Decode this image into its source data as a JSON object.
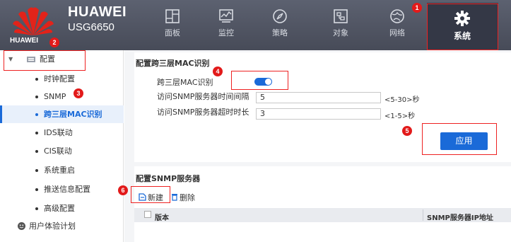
{
  "brand": {
    "name": "HUAWEI",
    "model": "USG6650",
    "logo_text": "HUAWEI"
  },
  "nav": [
    {
      "label": "面板",
      "icon": "dashboard-icon"
    },
    {
      "label": "监控",
      "icon": "monitor-chart-icon"
    },
    {
      "label": "策略",
      "icon": "compass-icon"
    },
    {
      "label": "对象",
      "icon": "object-icon"
    },
    {
      "label": "网络",
      "icon": "globe-network-icon"
    },
    {
      "label": "系统",
      "icon": "gear-icon",
      "active": true
    }
  ],
  "sidebar": {
    "group": "配置",
    "items": [
      "时钟配置",
      "SNMP",
      "跨三层MAC识别",
      "IDS联动",
      "CIS联动",
      "系统重启",
      "推送信息配置",
      "高级配置"
    ],
    "footer": "用户体验计划"
  },
  "section1": {
    "title": "配置跨三层MAC识别",
    "toggle_label": "跨三层MAC识别",
    "toggle_on": true,
    "interval_label": "访问SNMP服务器时间间隔",
    "interval_value": "5",
    "interval_hint": "<5-30>秒",
    "timeout_label": "访问SNMP服务器超时时长",
    "timeout_value": "3",
    "timeout_hint": "<1-5>秒",
    "apply_label": "应用"
  },
  "section2": {
    "title": "配置SNMP服务器",
    "new_label": "新建",
    "delete_label": "删除",
    "columns": [
      "版本",
      "SNMP服务器IP地址"
    ]
  },
  "annotations": [
    "1",
    "2",
    "3",
    "4",
    "5",
    "6"
  ],
  "colors": {
    "accent": "#1a6ad8",
    "annotation": "#e21a1a",
    "topbar": "#4e5260"
  }
}
